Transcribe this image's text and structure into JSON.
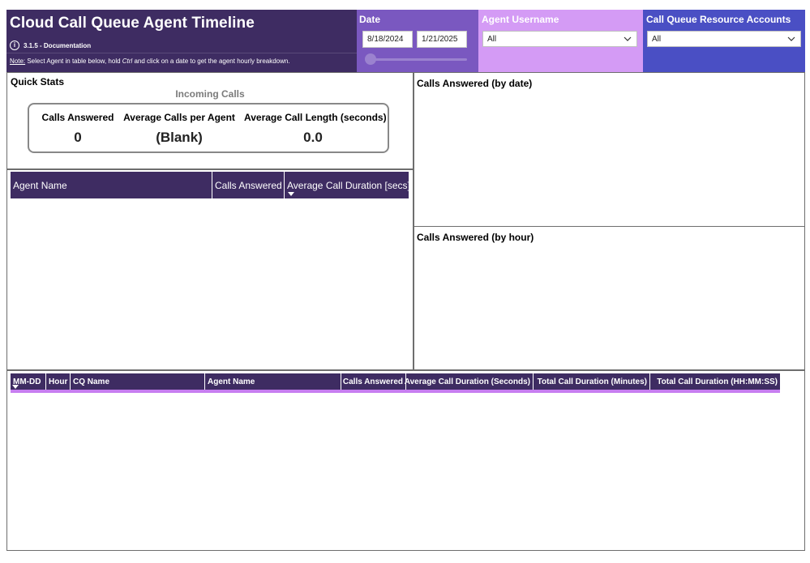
{
  "header": {
    "title": "Cloud Call Queue Agent Timeline",
    "version": "3.1.5 - Documentation",
    "note_prefix": "Note:",
    "note_a": " Select Agent in table below, hold ",
    "note_ctrl": "Ctrl",
    "note_b": " and click on a date to get the agent hourly breakdown."
  },
  "date_filter": {
    "label": "Date",
    "start": "8/18/2024",
    "end": "1/21/2025"
  },
  "agent_filter": {
    "label": "Agent Username",
    "value": "All"
  },
  "cq_filter": {
    "label": "Call Queue Resource Accounts",
    "value": "All"
  },
  "quick_stats": {
    "title": "Quick Stats",
    "subtitle": "Incoming Calls",
    "kpis": [
      {
        "label": "Calls Answered",
        "value": "0"
      },
      {
        "label": "Average Calls per Agent",
        "value": "(Blank)"
      },
      {
        "label": "Average Call Length (seconds)",
        "value": "0.0"
      }
    ]
  },
  "agent_table": {
    "columns": [
      "Agent Name",
      "Calls Answered",
      "Average Call Duration [secs]"
    ]
  },
  "charts": {
    "by_date_title": "Calls Answered (by date)",
    "by_hour_title": "Calls Answered (by hour)"
  },
  "detail_table": {
    "columns": [
      "MM-DD",
      "Hour",
      "CQ Name",
      "Agent Name",
      "Calls Answered",
      "Average Call Duration (Seconds)",
      "Total Call Duration (Minutes)",
      "Total Call Duration (HH:MM:SS)"
    ]
  },
  "colors": {
    "header_dark": "#3e2c62",
    "date_slicer": "#7a58c0",
    "agent_slicer": "#d49bf5",
    "cq_slicer": "#4a4fc4",
    "accent_line": "#c77ef0"
  }
}
